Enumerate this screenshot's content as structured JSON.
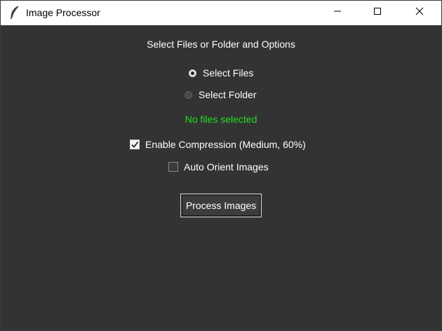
{
  "window": {
    "title": "Image Processor",
    "icons": {
      "app": "feather-icon",
      "minimize": "minimize-icon",
      "maximize": "maximize-icon",
      "close": "close-icon"
    }
  },
  "main": {
    "heading": "Select Files or Folder and Options",
    "source_options": [
      {
        "label": "Select Files",
        "selected": true
      },
      {
        "label": "Select Folder",
        "selected": false
      }
    ],
    "status_text": "No files selected",
    "options": {
      "compression_label": "Enable Compression (Medium, 60%)",
      "compression_checked": true,
      "auto_orient_label": "Auto Orient Images",
      "auto_orient_checked": false
    },
    "process_button": "Process Images"
  },
  "colors": {
    "background": "#333333",
    "text": "#ffffff",
    "status": "#1fe01f",
    "titlebar": "#ffffff"
  }
}
